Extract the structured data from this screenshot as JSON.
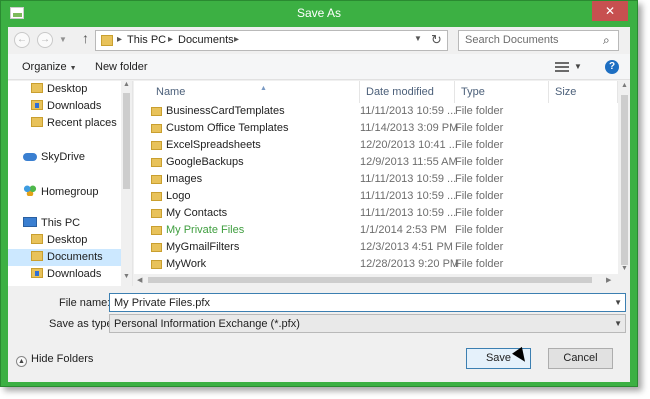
{
  "window": {
    "title": "Save As",
    "close_label": "✕"
  },
  "address": {
    "segments": [
      "This PC",
      "Documents"
    ],
    "refresh_glyph": "↻"
  },
  "search": {
    "placeholder": "Search Documents"
  },
  "toolbar": {
    "organize_label": "Organize",
    "new_folder_label": "New folder",
    "help_label": "?"
  },
  "nav": {
    "items": [
      {
        "label": "Desktop",
        "icon": "desktop-icon"
      },
      {
        "label": "Downloads",
        "icon": "downloads-icon"
      },
      {
        "label": "Recent places",
        "icon": "recent-places-icon"
      },
      {
        "label": "SkyDrive",
        "icon": "skydrive-icon"
      },
      {
        "label": "Homegroup",
        "icon": "homegroup-icon"
      },
      {
        "label": "This PC",
        "icon": "this-pc-icon"
      },
      {
        "label": "Desktop",
        "icon": "desktop-icon"
      },
      {
        "label": "Documents",
        "icon": "documents-icon",
        "selected": true
      },
      {
        "label": "Downloads",
        "icon": "downloads-icon"
      }
    ]
  },
  "file_list": {
    "columns": [
      "Name",
      "Date modified",
      "Type",
      "Size"
    ],
    "rows": [
      {
        "name": "BusinessCardTemplates",
        "date": "11/11/2013 10:59 ...",
        "type": "File folder"
      },
      {
        "name": "Custom Office Templates",
        "date": "11/14/2013 3:09 PM",
        "type": "File folder"
      },
      {
        "name": "ExcelSpreadsheets",
        "date": "12/20/2013 10:41 ...",
        "type": "File folder"
      },
      {
        "name": "GoogleBackups",
        "date": "12/9/2013 11:55 AM",
        "type": "File folder"
      },
      {
        "name": "Images",
        "date": "11/11/2013 10:59 ...",
        "type": "File folder"
      },
      {
        "name": "Logo",
        "date": "11/11/2013 10:59 ...",
        "type": "File folder"
      },
      {
        "name": "My Contacts",
        "date": "11/11/2013 10:59 ...",
        "type": "File folder"
      },
      {
        "name": "My Private Files",
        "date": "1/1/2014 2:53 PM",
        "type": "File folder",
        "highlight": true
      },
      {
        "name": "MyGmailFilters",
        "date": "12/3/2013 4:51 PM",
        "type": "File folder"
      },
      {
        "name": "MyWork",
        "date": "12/28/2013 9:20 PM",
        "type": "File folder"
      }
    ]
  },
  "form": {
    "file_name_label": "File name:",
    "file_name_value": "My Private Files.pfx",
    "save_type_label": "Save as type:",
    "save_type_value": "Personal Information Exchange (*.pfx)"
  },
  "footer": {
    "hide_folders_label": "Hide Folders",
    "save_label": "Save",
    "cancel_label": "Cancel"
  },
  "colors": {
    "frame": "#3cb043",
    "highlight_text": "#3f9e3f",
    "selection": "#cce8ff"
  }
}
